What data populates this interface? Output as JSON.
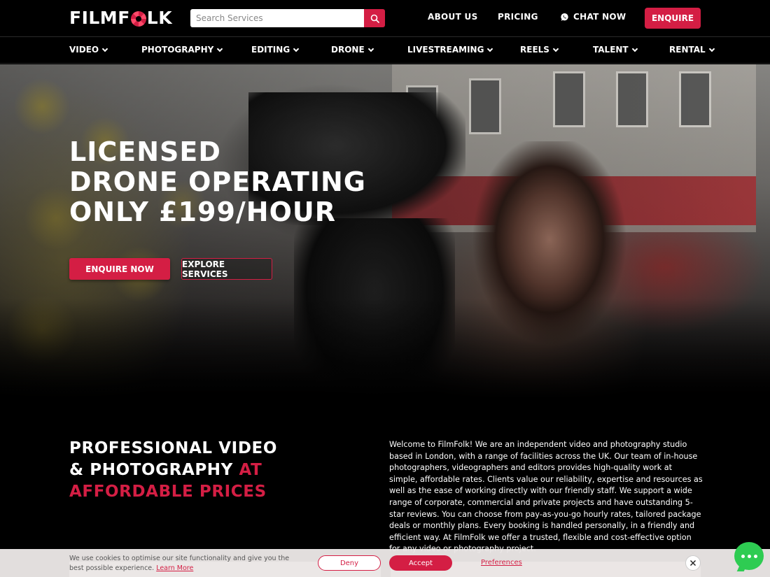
{
  "header": {
    "logo_text_1": "FILMF",
    "logo_text_2": "LK",
    "search_placeholder": "Search Services",
    "nav": {
      "about": "ABOUT US",
      "pricing": "PRICING",
      "chat": "CHAT NOW",
      "enquire": "ENQUIRE"
    }
  },
  "mainnav": {
    "items": [
      {
        "label": "VIDEO"
      },
      {
        "label": "PHOTOGRAPHY"
      },
      {
        "label": "EDITING"
      },
      {
        "label": "DRONE"
      },
      {
        "label": "LIVESTREAMING"
      },
      {
        "label": "REELS"
      },
      {
        "label": "TALENT"
      },
      {
        "label": "RENTAL"
      }
    ]
  },
  "hero": {
    "title_line_1": "LICENSED",
    "title_line_2": "DRONE OPERATING",
    "title_line_3": "ONLY £199/HOUR",
    "enquire_now": "ENQUIRE NOW",
    "explore_services": "EXPLORE SERVICES"
  },
  "intro": {
    "heading_line_1": "PROFESSIONAL VIDEO",
    "heading_line_2a": "& PHOTOGRAPHY ",
    "heading_line_2b": "AT",
    "heading_line_3": "AFFORDABLE PRICES",
    "body": "Welcome to FilmFolk! We are an independent video and photography studio based in London, with a range of facilities across the UK. Our team of in-house photographers, videographers and editors provides high-quality work at simple, affordable rates. Clients value our reliability, expertise and resources as well as the ease of working directly with our friendly staff. We support a wide range of corporate, commercial and private projects and have outstanding 5-star reviews. You can choose from pay-as-you-go hourly rates, tailored package deals or monthly plans. Every booking is handled personally, in a friendly and efficient way. At FilmFolk we offer a trusted, flexible and cost-effective option for any video or photography project."
  },
  "cookie": {
    "text": "We use cookies to optimise our site functionality and give you the best possible experience. ",
    "learn_more": "Learn More",
    "deny": "Deny",
    "accept": "Accept",
    "preferences": "Preferences"
  },
  "colors": {
    "accent": "#d41e44",
    "background": "#000000",
    "chat": "#2ecc52"
  },
  "icons": {
    "search": "search-icon",
    "whatsapp": "whatsapp-icon",
    "chevron": "chevron-down-icon",
    "close": "close-icon",
    "chat": "chat-bubble-icon"
  }
}
